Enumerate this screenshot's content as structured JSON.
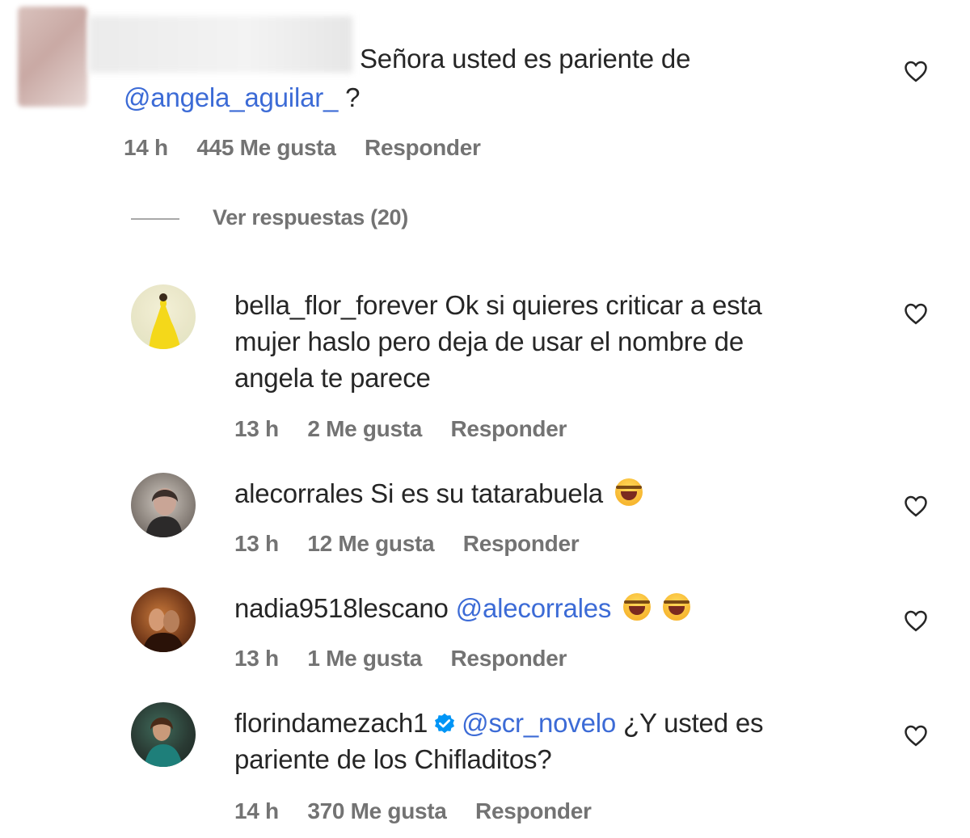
{
  "comments": [
    {
      "text": "Señora usted es pariente de",
      "mention": "@angela_aguilar_",
      "text_after": " ?",
      "time": "14 h",
      "likes": "445 Me gusta",
      "reply": "Responder"
    },
    {
      "username": "bella_flor_forever",
      "text": " Ok si quieres criticar a esta mujer haslo pero deja de usar el nombre de angela te parece",
      "time": "13 h",
      "likes": "2 Me gusta",
      "reply": "Responder"
    },
    {
      "username": "alecorrales",
      "text": " Si es su tatarabuela",
      "time": "13 h",
      "likes": "12 Me gusta",
      "reply": "Responder"
    },
    {
      "username": "nadia9518lescano",
      "mention": "@alecorrales",
      "time": "13 h",
      "likes": "1 Me gusta",
      "reply": "Responder"
    },
    {
      "username": "florindamezach1",
      "mention": "@scr_novelo",
      "text": " ¿Y usted es pariente de los Chifladitos?",
      "time": "14 h",
      "likes": "370 Me gusta",
      "reply": "Responder"
    }
  ],
  "view_replies": "Ver respuestas (20)",
  "icons": {
    "like": "heart-outline-icon",
    "emoji": "rolling-on-floor-laughing-emoji",
    "verified": "verified-badge-icon"
  },
  "colors": {
    "mention": "#3c6bd6",
    "meta": "#737373",
    "verified": "#0095f6"
  }
}
